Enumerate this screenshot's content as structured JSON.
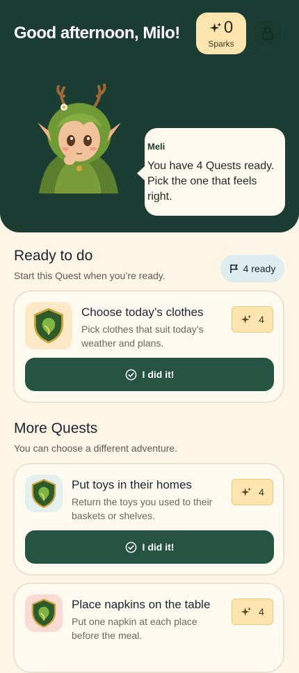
{
  "header": {
    "greeting": "Good afternoon, Milo!",
    "sparks": {
      "count": "0",
      "label": "Sparks"
    },
    "lock_icon": "lock-icon"
  },
  "mascot": {
    "name": "Meli",
    "message": "You have 4 Quests ready. Pick the one that feels right."
  },
  "ready_section": {
    "title": "Ready to do",
    "subtitle": "Start this Quest when you’re ready.",
    "badge": "4 ready",
    "badge_icon": "flag-icon"
  },
  "more_section": {
    "title": "More Quests",
    "subtitle": "You can choose a different adventure."
  },
  "quests": [
    {
      "title": "Choose today’s clothes",
      "desc": "Pick clothes that suit today’s weather and plans.",
      "reward": "4",
      "button": "I did it!",
      "icon_bg": "#fbe9c6"
    },
    {
      "title": "Put toys in their homes",
      "desc": "Return the toys you used to their baskets or shelves.",
      "reward": "4",
      "button": "I did it!",
      "icon_bg": "#e4f0ee"
    },
    {
      "title": "Place napkins on the table",
      "desc": "Put one napkin at each place before the meal.",
      "reward": "4",
      "icon_bg": "#f8dcd4"
    }
  ],
  "colors": {
    "header_bg": "#1c3d33",
    "page_bg": "#fdf5e6",
    "accent_button": "#275442",
    "sparks_bg": "#fbe4ad"
  }
}
